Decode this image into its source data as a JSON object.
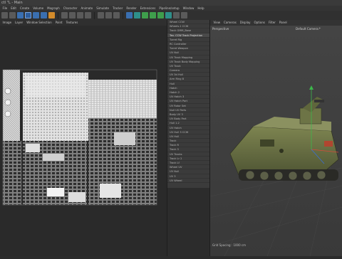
{
  "app": {
    "title": "ctl \"L - Main"
  },
  "menu": [
    "File",
    "Edit",
    "Create",
    "Volume",
    "Mograph",
    "Character",
    "Animate",
    "Simulate",
    "Tracker",
    "Render",
    "Extensions",
    "Pipeline/setup",
    "Window",
    "Help"
  ],
  "toolbar": {
    "icons": [
      "undo-icon",
      "redo-icon",
      "live-selection-icon",
      "move-icon",
      "scale-icon",
      "rotate-icon",
      "recent-tool-icon",
      "x-axis-icon",
      "y-axis-icon",
      "z-axis-icon",
      "coordinate-system-icon",
      "render-region-icon",
      "render-view-icon",
      "render-settings-icon",
      "cube-icon",
      "pen-icon",
      "subdivision-icon",
      "array-icon",
      "deformer-icon",
      "environment-icon",
      "camera-icon",
      "light-icon"
    ]
  },
  "uv_editor": {
    "menu": [
      "Image",
      "Layer",
      "Window Selection",
      "Paint",
      "Textures"
    ]
  },
  "object_manager": {
    "items": [
      "Wheel CCW",
      "Wheels.1 CCW",
      "Track GMM_Base",
      "Tex. CCW Track Projection",
      "Turret Rig",
      "RC Controller",
      "Turret Weapon",
      "UV Null",
      "UV Track Mapping",
      "UV Track Body Mapping",
      "UV Track",
      "Camera",
      "UV 3d Hull",
      "Arm Ring 8",
      "Hull",
      "Hatch",
      "Hatch 2",
      "UV Hatch 3",
      "UV Hatch Part",
      "UV Rotor Set",
      "Null UV Parts",
      "Body UV 3",
      "UV Body Part",
      "Hull 1.2",
      "UV Hatch",
      "UV Hull 3 CCW",
      "UV Hull",
      "Track",
      "Track R",
      "Track 3",
      "UV Tracks",
      "Track Lr 2",
      "Track Lf",
      "Wheel UV",
      "UV Null",
      "UV 3",
      "UV Wheel"
    ],
    "highlighted_index": 3
  },
  "viewport": {
    "menu": [
      "View",
      "Cameras",
      "Display",
      "Options",
      "Filter",
      "Panel"
    ],
    "label": "Perspective",
    "camera": "Default Camera:*",
    "footer": "Grid Spacing : 1000 cm"
  }
}
